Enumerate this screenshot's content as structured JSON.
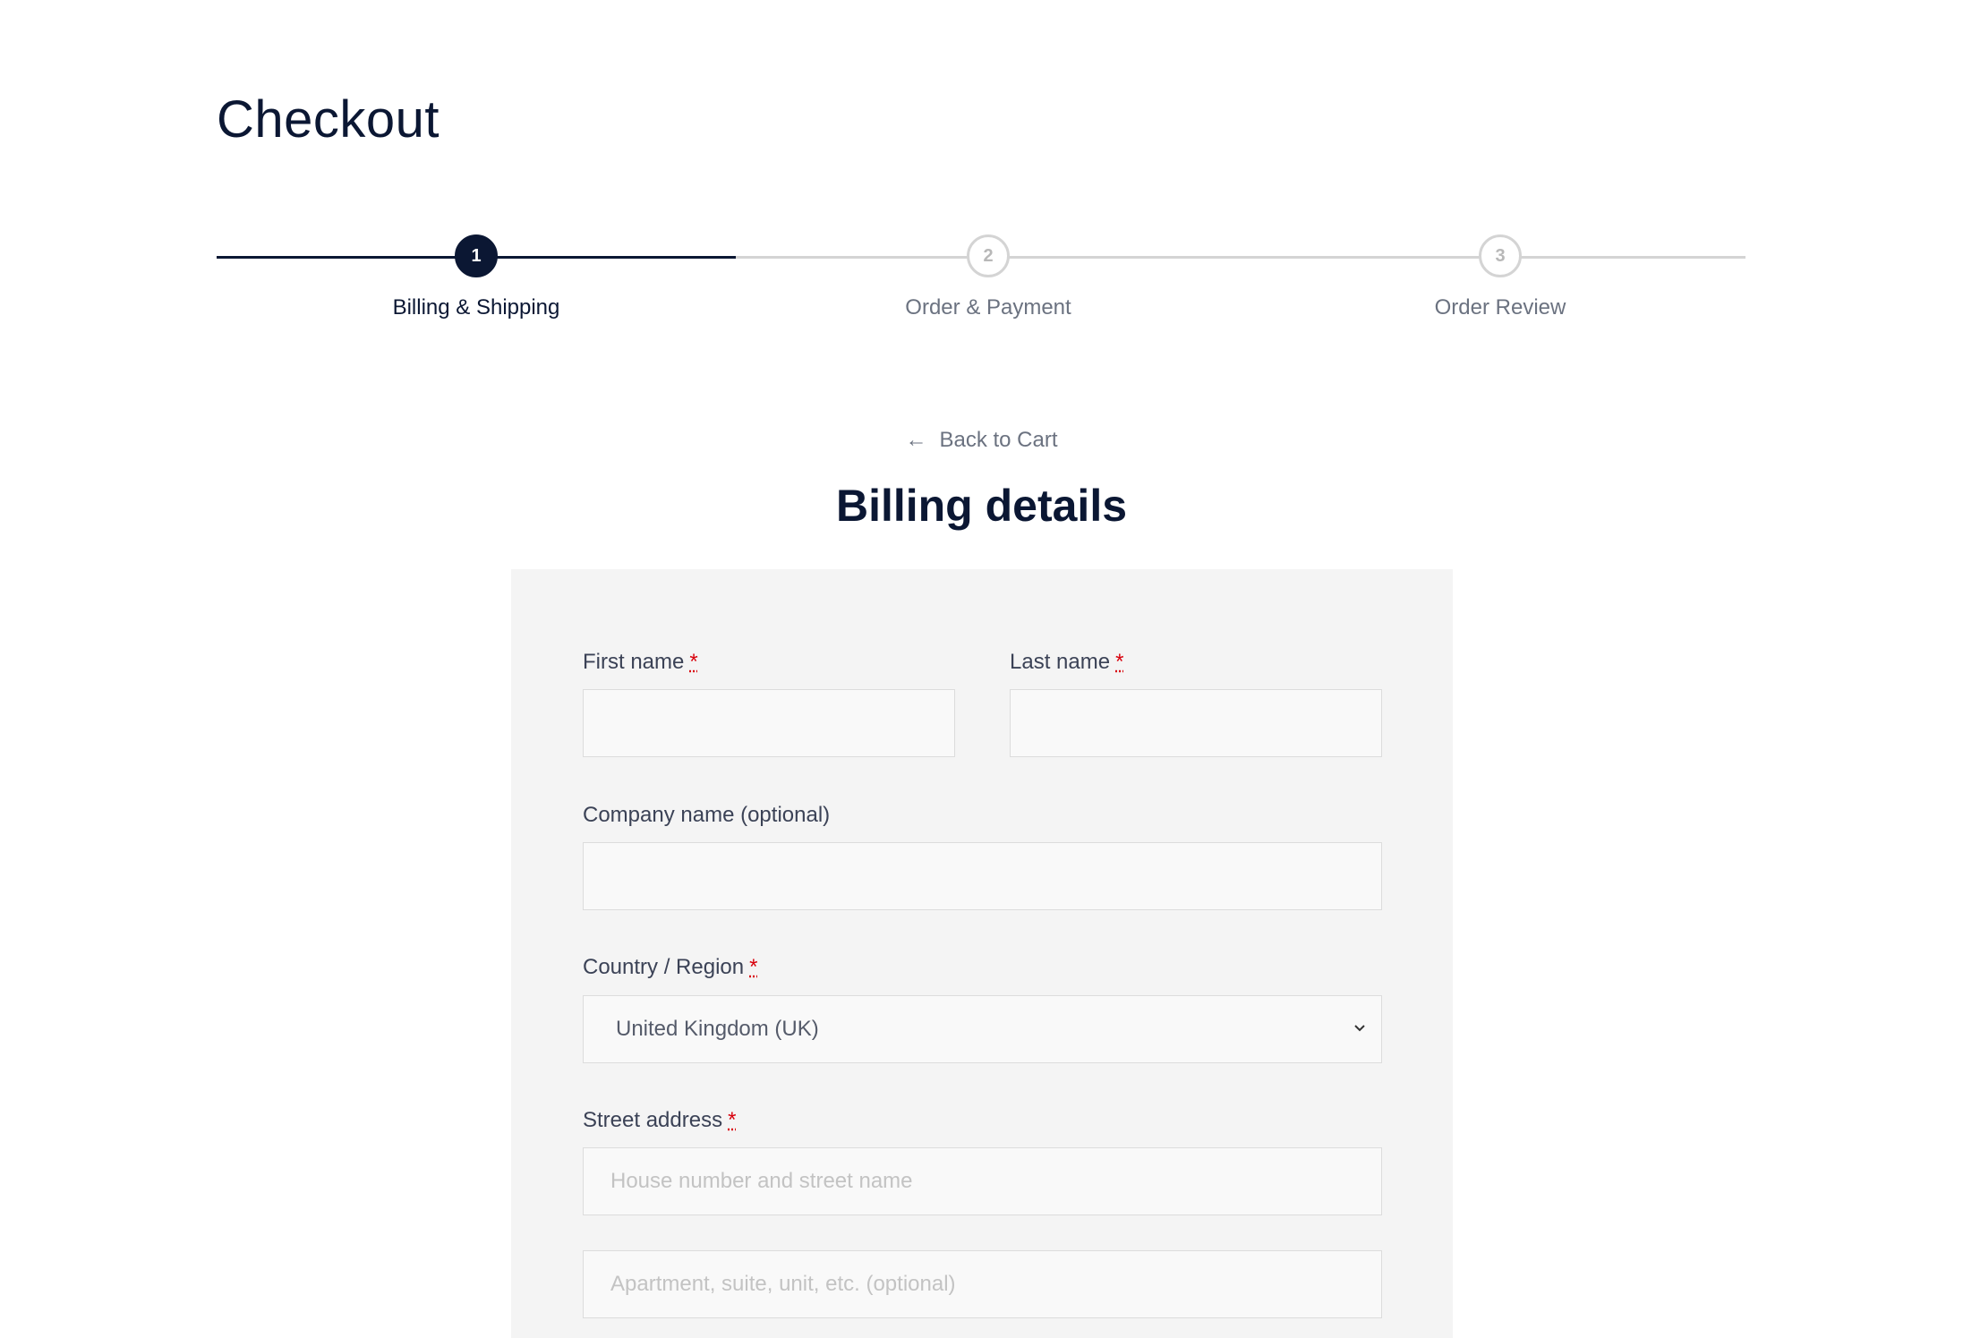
{
  "page": {
    "title": "Checkout"
  },
  "stepper": {
    "steps": [
      {
        "number": "1",
        "label": "Billing & Shipping",
        "state": "active"
      },
      {
        "number": "2",
        "label": "Order & Payment",
        "state": "upcoming"
      },
      {
        "number": "3",
        "label": "Order Review",
        "state": "upcoming"
      }
    ]
  },
  "back_link": {
    "arrow": "←",
    "label": "Back to Cart"
  },
  "billing": {
    "title": "Billing details",
    "required_mark": "*",
    "first_name": {
      "label": "First name",
      "value": ""
    },
    "last_name": {
      "label": "Last name",
      "value": ""
    },
    "company": {
      "label": "Company name (optional)",
      "value": ""
    },
    "country": {
      "label": "Country / Region",
      "selected": "United Kingdom (UK)"
    },
    "street": {
      "label": "Street address",
      "line1_placeholder": "House number and street name",
      "line2_placeholder": "Apartment, suite, unit, etc. (optional)"
    }
  },
  "colors": {
    "primary": "#0b1733",
    "muted": "#6b7280",
    "required": "#d8000c",
    "panel": "#f4f4f4"
  }
}
